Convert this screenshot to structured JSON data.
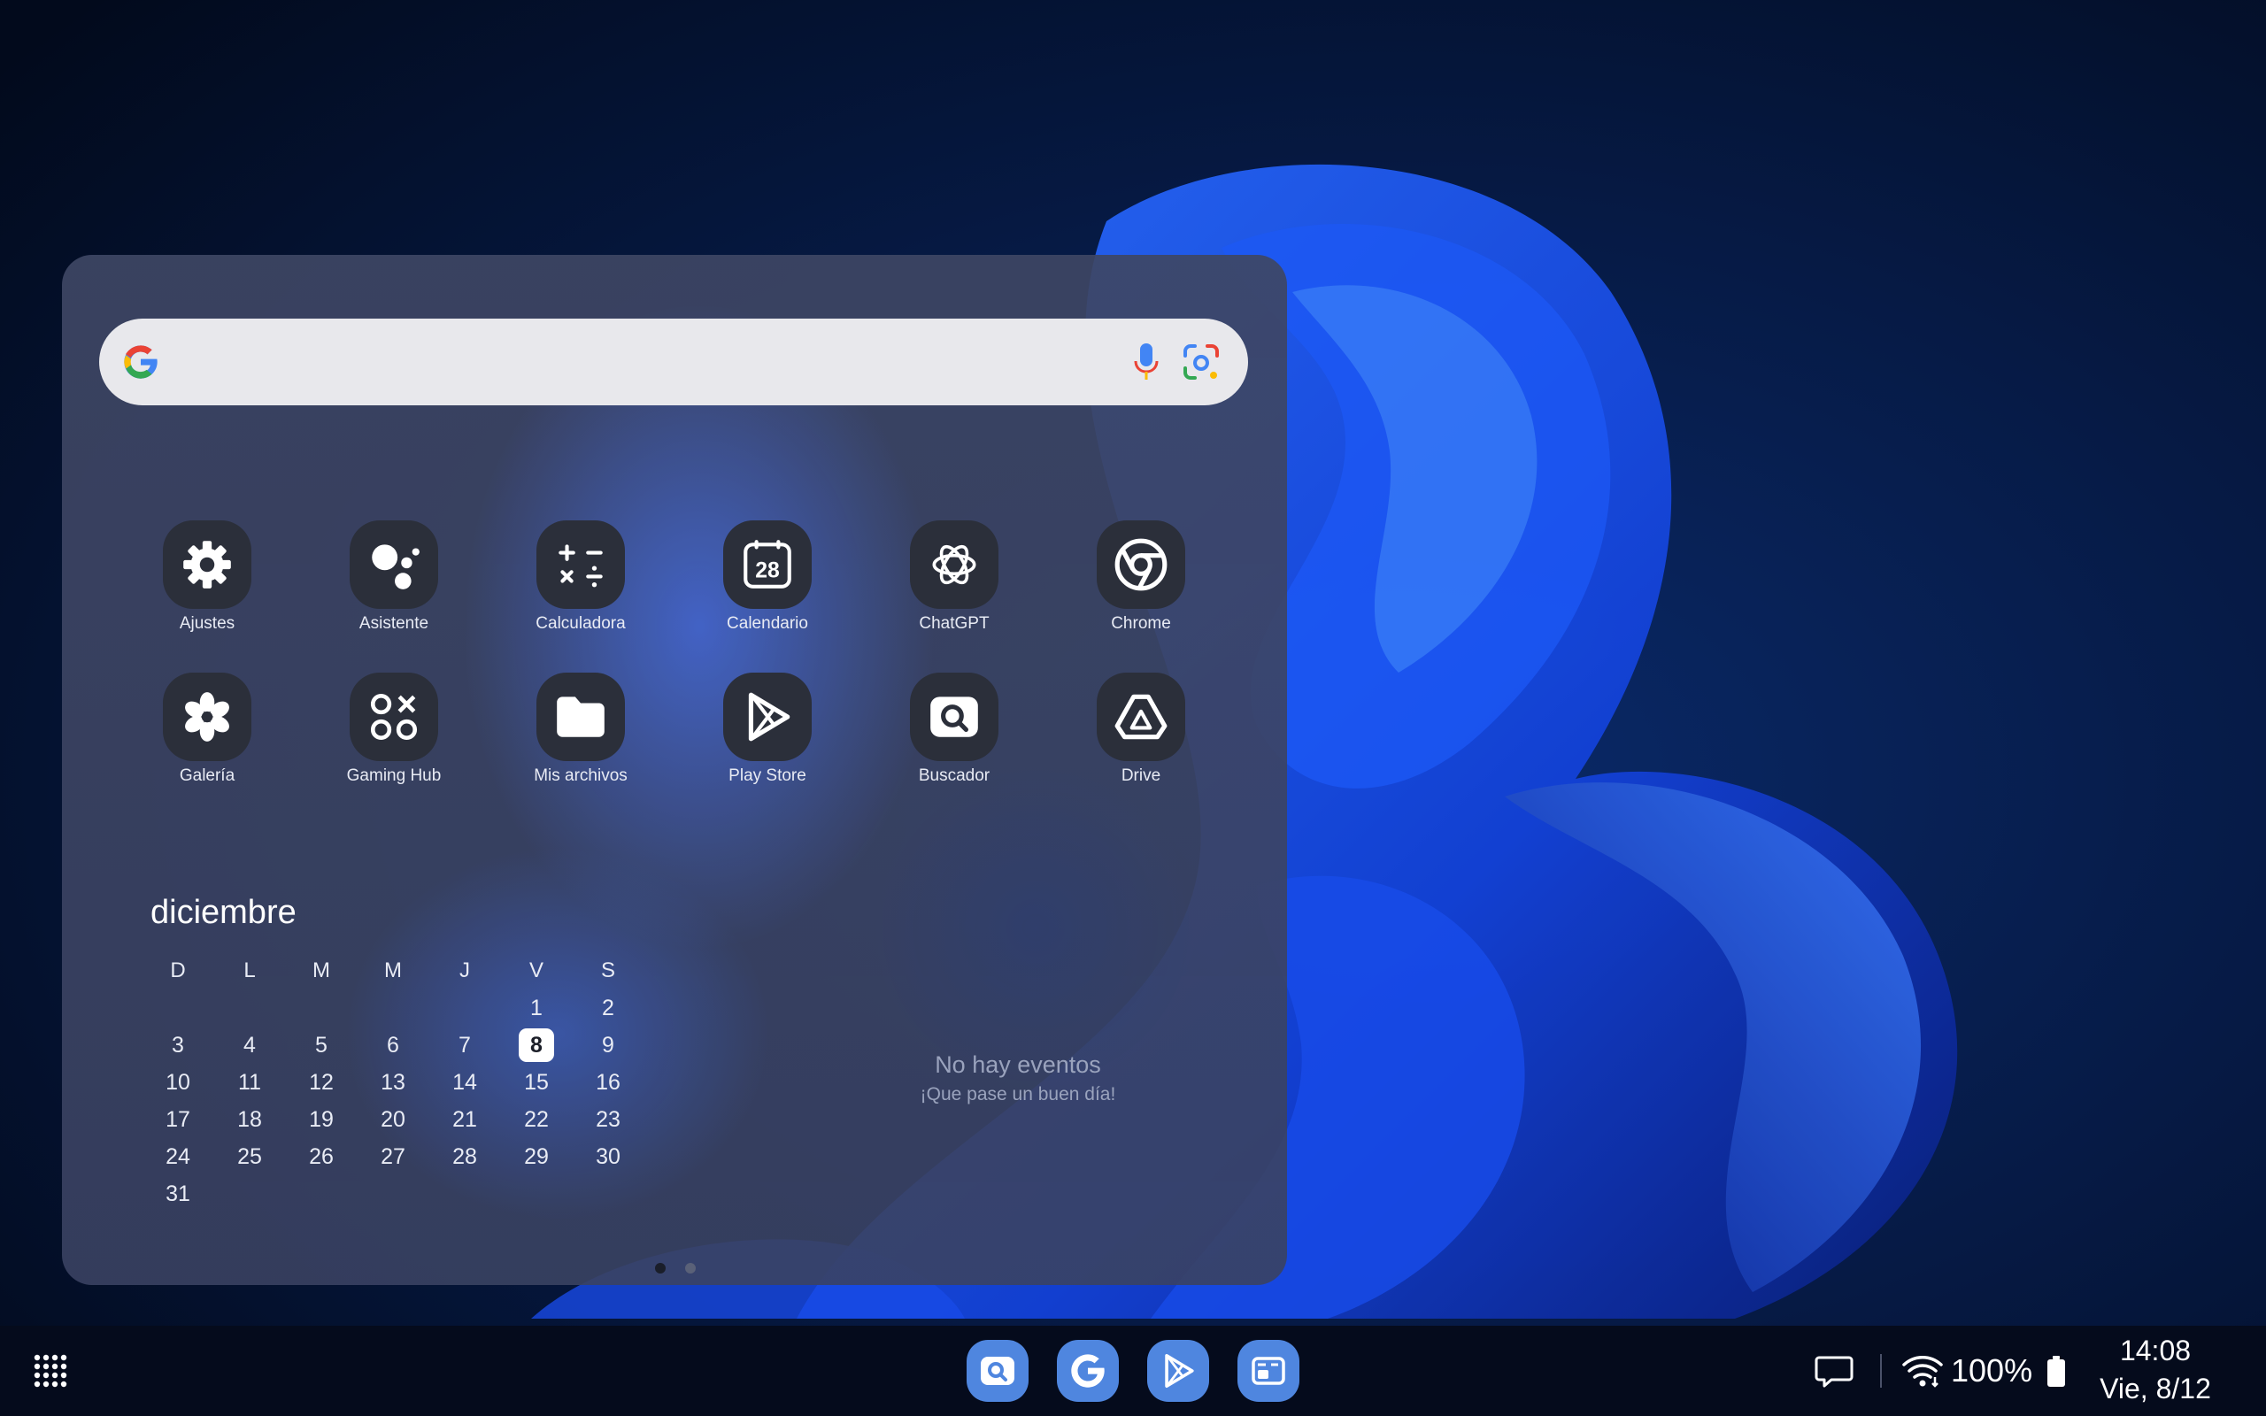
{
  "colors": {
    "panel": "#3e4664",
    "search_bar": "#e8e8ec",
    "tile": "#2b2f3a",
    "dock_accent": "#4f86df",
    "taskbar": "#050b1c"
  },
  "search": {
    "logo_icon": "google-g-icon",
    "voice_icon": "microphone-icon",
    "lens_icon": "google-lens-icon"
  },
  "apps": [
    {
      "label": "Ajustes",
      "icon": "gear-icon"
    },
    {
      "label": "Asistente",
      "icon": "assistant-icon"
    },
    {
      "label": "Calculadora",
      "icon": "calculator-icon"
    },
    {
      "label": "Calendario",
      "icon": "calendar-icon",
      "badge": "28"
    },
    {
      "label": "ChatGPT",
      "icon": "chatgpt-icon"
    },
    {
      "label": "Chrome",
      "icon": "chrome-icon"
    },
    {
      "label": "Galería",
      "icon": "flower-icon"
    },
    {
      "label": "Gaming Hub",
      "icon": "gaming-hub-icon"
    },
    {
      "label": "Mis archivos",
      "icon": "folder-icon"
    },
    {
      "label": "Play Store",
      "icon": "play-store-icon"
    },
    {
      "label": "Buscador",
      "icon": "search-app-icon"
    },
    {
      "label": "Drive",
      "icon": "drive-icon"
    }
  ],
  "calendar": {
    "month": "diciembre",
    "weekdays": [
      "D",
      "L",
      "M",
      "M",
      "J",
      "V",
      "S"
    ],
    "weeks": [
      [
        "",
        "",
        "",
        "",
        "",
        "1",
        "2"
      ],
      [
        "3",
        "4",
        "5",
        "6",
        "7",
        "8",
        "9"
      ],
      [
        "10",
        "11",
        "12",
        "13",
        "14",
        "15",
        "16"
      ],
      [
        "17",
        "18",
        "19",
        "20",
        "21",
        "22",
        "23"
      ],
      [
        "24",
        "25",
        "26",
        "27",
        "28",
        "29",
        "30"
      ],
      [
        "31",
        "",
        "",
        "",
        "",
        "",
        ""
      ]
    ],
    "today": "8",
    "no_events_title": "No hay eventos",
    "no_events_subtitle": "¡Que pase un buen día!"
  },
  "page_indicator": {
    "pages": 2,
    "current": 1
  },
  "taskbar": {
    "apps_button_icon": "app-grid-icon",
    "dock": [
      {
        "name": "search-app",
        "icon": "search-app-icon"
      },
      {
        "name": "google",
        "icon": "google-g-icon"
      },
      {
        "name": "play-store",
        "icon": "play-store-icon"
      },
      {
        "name": "multi-window",
        "icon": "multi-window-icon"
      }
    ],
    "messages_icon": "chat-bubble-icon",
    "wifi_icon": "wifi-icon",
    "battery_text": "100%",
    "battery_icon": "battery-icon",
    "time": "14:08",
    "date": "Vie, 8/12"
  }
}
